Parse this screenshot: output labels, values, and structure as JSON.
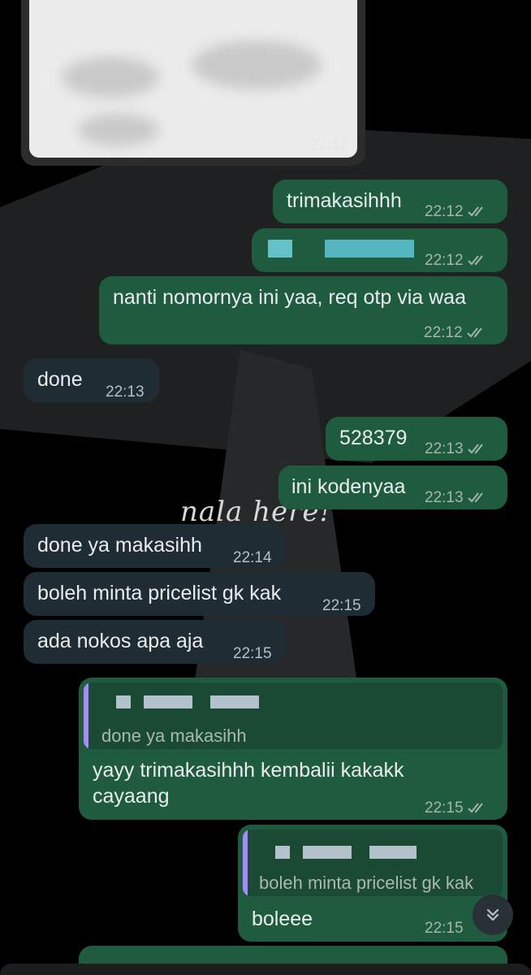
{
  "image_message": {
    "time": "22:12"
  },
  "messages": [
    {
      "id": "m1",
      "dir": "out",
      "text": "trimakasihhh",
      "time": "22:12"
    },
    {
      "id": "m2",
      "dir": "out",
      "text": "",
      "time": "22:12",
      "redacted": true
    },
    {
      "id": "m3",
      "dir": "out",
      "text": "nanti nomornya ini yaa, req otp via waa",
      "time": "22:12"
    },
    {
      "id": "m4",
      "dir": "in",
      "text": "done",
      "time": "22:13"
    },
    {
      "id": "m5",
      "dir": "out",
      "text": "528379",
      "time": "22:13"
    },
    {
      "id": "m6",
      "dir": "out",
      "text": "ini kodenyaa",
      "time": "22:13"
    },
    {
      "id": "m7",
      "dir": "in",
      "text": "done ya makasihh",
      "time": "22:14"
    },
    {
      "id": "m8",
      "dir": "in",
      "text": "boleh minta pricelist gk kak",
      "time": "22:15"
    },
    {
      "id": "m9",
      "dir": "in",
      "text": "ada nokos apa aja",
      "time": "22:15"
    },
    {
      "id": "m10",
      "dir": "out",
      "quote": "done ya makasihh",
      "text_line1": "yayy trimakasihhh kembalii kakakk",
      "text_line2": "cayaang",
      "time": "22:15"
    },
    {
      "id": "m11",
      "dir": "out",
      "quote": "boleh minta pricelist gk kak",
      "text": "boleee",
      "time": "22:15"
    }
  ],
  "wallpaper_text": "nala here!",
  "colors": {
    "incoming": "#202c33",
    "outgoing": "#1f5c3f",
    "quote_bar": "#a78bfa"
  },
  "icons": {
    "read_receipt": "double-check-icon",
    "scroll_down": "chevrons-down-icon"
  }
}
